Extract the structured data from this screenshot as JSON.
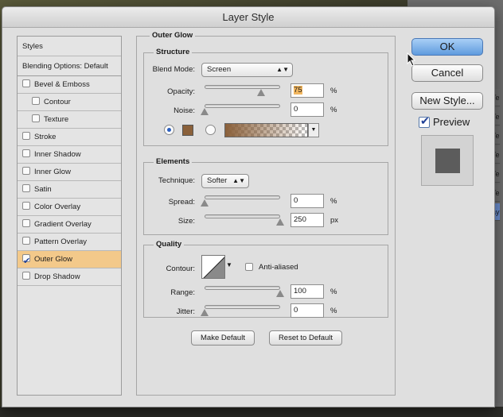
{
  "dialog": {
    "title": "Layer Style"
  },
  "sidebar": {
    "header": "Styles",
    "blending": "Blending Options: Default",
    "items": [
      {
        "label": "Bevel & Emboss",
        "checked": false,
        "sub": false
      },
      {
        "label": "Contour",
        "checked": false,
        "sub": true
      },
      {
        "label": "Texture",
        "checked": false,
        "sub": true
      },
      {
        "label": "Stroke",
        "checked": false,
        "sub": false
      },
      {
        "label": "Inner Shadow",
        "checked": false,
        "sub": false
      },
      {
        "label": "Inner Glow",
        "checked": false,
        "sub": false
      },
      {
        "label": "Satin",
        "checked": false,
        "sub": false
      },
      {
        "label": "Color Overlay",
        "checked": false,
        "sub": false
      },
      {
        "label": "Gradient Overlay",
        "checked": false,
        "sub": false
      },
      {
        "label": "Pattern Overlay",
        "checked": false,
        "sub": false
      },
      {
        "label": "Outer Glow",
        "checked": true,
        "sub": false,
        "selected": true
      },
      {
        "label": "Drop Shadow",
        "checked": false,
        "sub": false
      }
    ]
  },
  "outer_glow": {
    "title": "Outer Glow",
    "structure": {
      "title": "Structure",
      "blend_mode_label": "Blend Mode:",
      "blend_mode_value": "Screen",
      "opacity_label": "Opacity:",
      "opacity_value": "75",
      "opacity_level": 0.75,
      "noise_label": "Noise:",
      "noise_value": "0",
      "noise_level": 0,
      "percent": "%",
      "swatch_color": "#8a603a"
    },
    "elements": {
      "title": "Elements",
      "technique_label": "Technique:",
      "technique_value": "Softer",
      "spread_label": "Spread:",
      "spread_value": "0",
      "spread_level": 0,
      "size_label": "Size:",
      "size_value": "250",
      "size_level": 1.0,
      "percent": "%",
      "px": "px"
    },
    "quality": {
      "title": "Quality",
      "contour_label": "Contour:",
      "anti_aliased_label": "Anti-aliased",
      "range_label": "Range:",
      "range_value": "100",
      "range_level": 1.0,
      "jitter_label": "Jitter:",
      "jitter_value": "0",
      "jitter_level": 0,
      "percent": "%"
    },
    "make_default": "Make Default",
    "reset_default": "Reset to Default"
  },
  "actions": {
    "ok": "OK",
    "cancel": "Cancel",
    "new_style": "New Style...",
    "preview": "Preview"
  },
  "background_panel": {
    "rows": [
      "Te",
      "Te",
      "Te",
      "Te",
      "Te",
      "Te",
      "ay"
    ]
  }
}
